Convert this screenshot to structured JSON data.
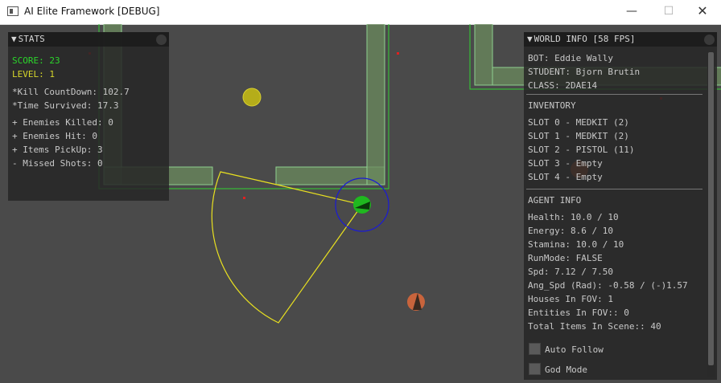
{
  "window": {
    "title": "AI Elite Framework [DEBUG]",
    "minimize_label": "—",
    "maximize_label": "☐",
    "close_label": "✕"
  },
  "stats_panel": {
    "header": "STATS",
    "score": "SCORE: 23",
    "level": "LEVEL: 1",
    "kill_countdown": "*Kill CountDown: 102.7",
    "time_survived": "*Time Survived: 17.3",
    "enemies_killed": "+ Enemies Killed: 0",
    "enemies_hit": "+ Enemies Hit: 0",
    "items_pickup": "+ Items PickUp: 3",
    "missed_shots": "- Missed Shots: 0"
  },
  "world_panel": {
    "header": "WORLD INFO [58 FPS]",
    "bot": "BOT: Eddie Wally",
    "student": "STUDENT: Bjorn Brutin",
    "class": "CLASS: 2DAE14",
    "inventory_header": "INVENTORY",
    "slots": [
      "SLOT 0 - MEDKIT (2)",
      "SLOT 1 - MEDKIT (2)",
      "SLOT 2 - PISTOL (11)",
      "SLOT 3 - Empty",
      "SLOT 4 - Empty"
    ],
    "agent_header": "AGENT INFO",
    "health": "Health: 10.0 / 10",
    "energy": "Energy: 8.6 / 10",
    "stamina": "Stamina: 10.0 / 10",
    "runmode": "RunMode: FALSE",
    "spd": "Spd: 7.12 / 7.50",
    "ang_spd": "Ang_Spd (Rad): -0.58 / (-)1.57",
    "houses_fov": "Houses In FOV: 1",
    "entities_fov": "Entities In FOV:: 0",
    "total_items": "Total Items In Scene:: 40",
    "auto_follow": "Auto Follow",
    "god_mode": "God Mode"
  },
  "colors": {
    "background": "#4a4a4a",
    "house_fill": "#6b8b5e",
    "house_outline": "#33d133",
    "fov_line": "#e8e020",
    "agent": "#1fb81f",
    "agent_ring": "#1a1ad6",
    "item": "#d4cc22",
    "enemy": "#c8643c",
    "marker": "#e02020",
    "score_text": "#2bd62b",
    "level_text": "#d6d62b"
  },
  "icons": [
    "window-app-icon",
    "collapse-triangle-icon",
    "close-circle-icon"
  ]
}
